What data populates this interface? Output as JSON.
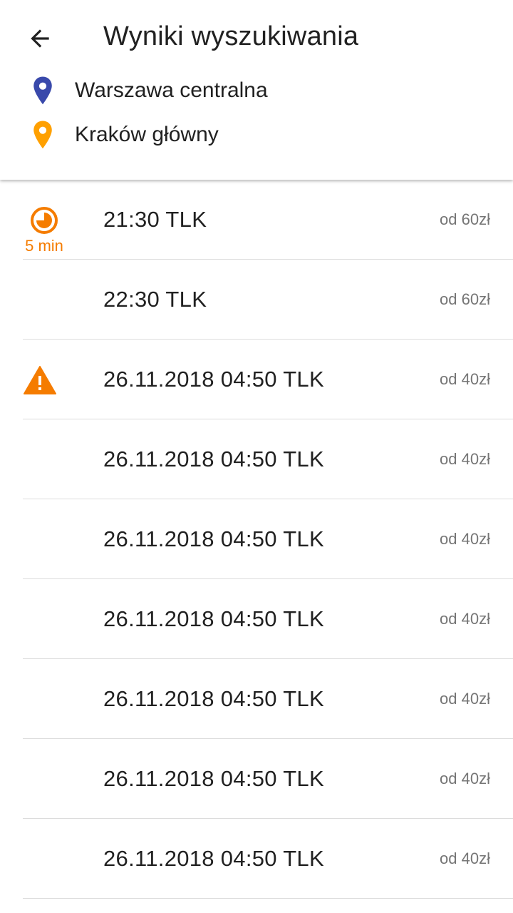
{
  "header": {
    "title": "Wyniki wyszukiwania",
    "from_station": "Warszawa centralna",
    "to_station": "Kraków główny"
  },
  "colors": {
    "from_pin": "#3949AB",
    "to_pin": "#FFA000",
    "accent_orange": "#F57C00",
    "warning": "#F57C00"
  },
  "icons": {
    "back": "arrow-back-icon",
    "from": "location-pin-icon",
    "to": "location-pin-icon",
    "delay": "clock-delay-icon",
    "warning": "warning-triangle-icon"
  },
  "results": [
    {
      "train": "21:30 TLK",
      "price": "od 60zł",
      "delay": "5 min",
      "warning": false
    },
    {
      "train": "22:30 TLK",
      "price": "od 60zł",
      "delay": null,
      "warning": false
    },
    {
      "train": "26.11.2018 04:50 TLK",
      "price": "od 40zł",
      "delay": null,
      "warning": true
    },
    {
      "train": "26.11.2018 04:50 TLK",
      "price": "od 40zł",
      "delay": null,
      "warning": false
    },
    {
      "train": "26.11.2018 04:50 TLK",
      "price": "od 40zł",
      "delay": null,
      "warning": false
    },
    {
      "train": "26.11.2018 04:50 TLK",
      "price": "od 40zł",
      "delay": null,
      "warning": false
    },
    {
      "train": "26.11.2018 04:50 TLK",
      "price": "od 40zł",
      "delay": null,
      "warning": false
    },
    {
      "train": "26.11.2018 04:50 TLK",
      "price": "od 40zł",
      "delay": null,
      "warning": false
    },
    {
      "train": "26.11.2018 04:50 TLK",
      "price": "od 40zł",
      "delay": null,
      "warning": false
    }
  ]
}
